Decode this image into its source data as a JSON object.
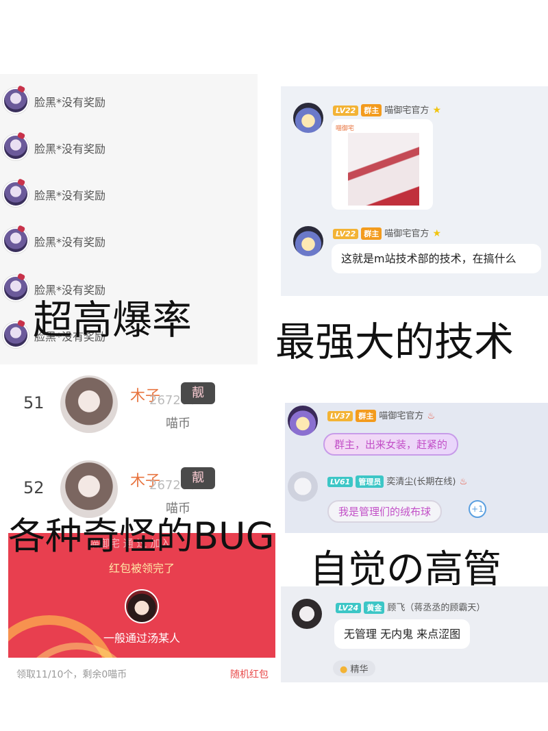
{
  "captions": {
    "top_left": "超高爆率",
    "top_right": "最强大的技术",
    "middle_left": "各种奇怪的BUG",
    "bottom_right": "自觉の高管"
  },
  "reward_list": {
    "items": [
      "脸黑*没有奖励",
      "脸黑*没有奖励",
      "脸黑*没有奖励",
      "脸黑*没有奖励",
      "脸黑*没有奖励",
      "脸黑*没有奖励"
    ]
  },
  "tech_chat": {
    "msg1": {
      "level": "LV22",
      "role": "群主",
      "nick": "喵御宅官方",
      "image_label": "喵御宅"
    },
    "msg2": {
      "level": "LV22",
      "role": "群主",
      "nick": "喵御宅官方",
      "text": "这就是m站技术部的技术，在搞什么"
    }
  },
  "rank": {
    "rows": [
      {
        "num": "51",
        "name": "木子",
        "ghost": "2672067",
        "tag": "靓",
        "coin": "喵币"
      },
      {
        "num": "52",
        "name": "木子",
        "ghost": "2672067",
        "tag": "靓",
        "coin": "喵币"
      }
    ]
  },
  "red_envelope": {
    "header_ghost": "喵御宅 通 过 加入",
    "title": "红包被领完了",
    "sender": "一般通过汤某人",
    "footer_left": "领取11/10个，剩余0喵币",
    "footer_right": "随机红包"
  },
  "admin_chat": {
    "msg1": {
      "level": "LV37",
      "role": "群主",
      "nick": "喵御宅官方",
      "text": "群主，出来女装，赶紧的"
    },
    "msg2": {
      "level": "LV61",
      "role": "管理员",
      "nick": "奕清尘(长期在线)",
      "text": "我是管理们的绒布球",
      "plus": "+1"
    }
  },
  "jing_chat": {
    "level": "LV24",
    "role": "黄金",
    "nick": "顾飞（蒋丞丞的顾霸天）",
    "text": "无管理 无内鬼 来点涩图",
    "tag": "精华"
  },
  "colors": {
    "red_envelope": "#e83f4f",
    "rank_name": "#e8743f",
    "badge_orange": "#f3b335",
    "badge_teal": "#3cc6c6"
  }
}
